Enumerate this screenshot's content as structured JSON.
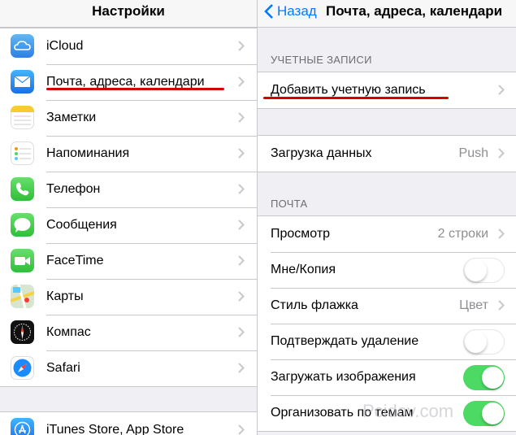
{
  "left": {
    "title": "Настройки",
    "items": [
      {
        "label": "iCloud",
        "icon": "icloud-icon"
      },
      {
        "label": "Почта, адреса, календари",
        "icon": "mail-icon"
      },
      {
        "label": "Заметки",
        "icon": "notes-icon"
      },
      {
        "label": "Напоминания",
        "icon": "reminders-icon"
      },
      {
        "label": "Телефон",
        "icon": "phone-icon"
      },
      {
        "label": "Сообщения",
        "icon": "messages-icon"
      },
      {
        "label": "FaceTime",
        "icon": "facetime-icon"
      },
      {
        "label": "Карты",
        "icon": "maps-icon"
      },
      {
        "label": "Компас",
        "icon": "compass-icon"
      },
      {
        "label": "Safari",
        "icon": "safari-icon"
      }
    ],
    "bottom_item": {
      "label": "iTunes Store, App Store",
      "icon": "app-store-icon"
    }
  },
  "right": {
    "back_label": "Назад",
    "title": "Почта, адреса, календари",
    "accounts_header": "УЧЕТНЫЕ ЗАПИСИ",
    "add_account": "Добавить учетную запись",
    "fetch_label": "Загрузка данных",
    "fetch_value": "Push",
    "mail_header": "ПОЧТА",
    "preview_label": "Просмотр",
    "preview_value": "2 строки",
    "cc_label": "Мне/Копия",
    "cc_on": false,
    "flag_label": "Стиль флажка",
    "flag_value": "Цвет",
    "confirm_delete_label": "Подтверждать удаление",
    "confirm_delete_on": false,
    "load_images_label": "Загружать изображения",
    "load_images_on": true,
    "thread_label": "Организовать по темам",
    "thread_on": true
  },
  "watermark": "Pcidov.com",
  "colors": {
    "accent": "#007aff",
    "toggle_on": "#4cd964",
    "annotation": "#d50000"
  }
}
